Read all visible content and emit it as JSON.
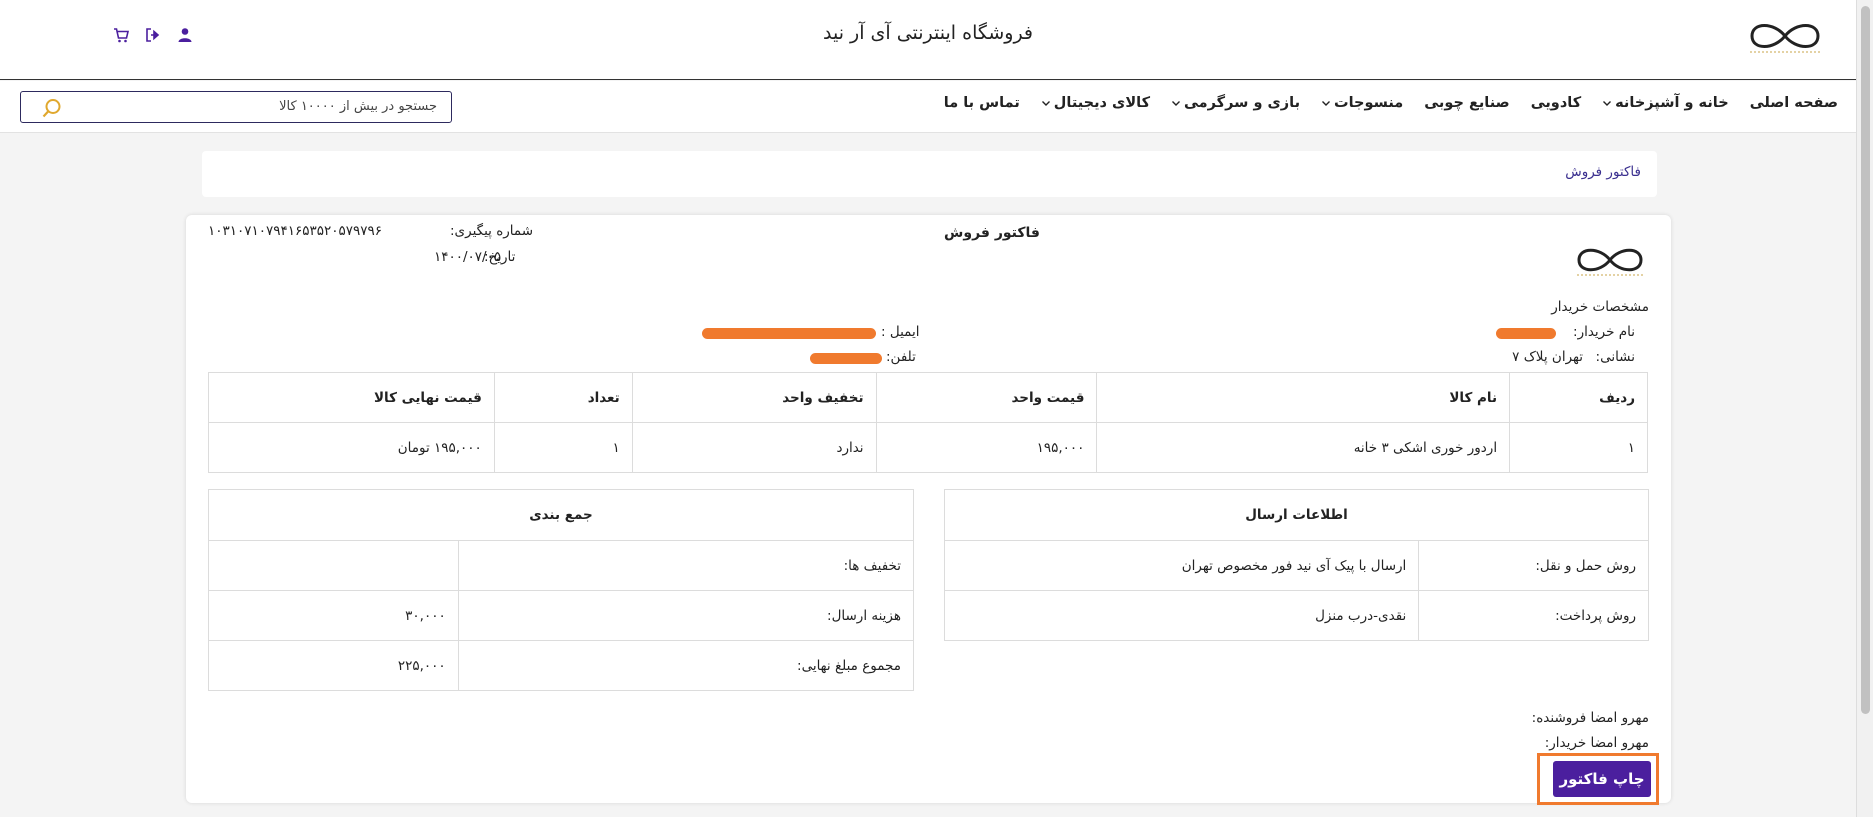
{
  "header": {
    "site_title": "فروشگاه اینترنتی آی آر نید",
    "icons": [
      "cart-icon",
      "logout-icon",
      "user-icon"
    ]
  },
  "nav": {
    "items": [
      {
        "label": "صفحه اصلی",
        "has_dropdown": false
      },
      {
        "label": "خانه و آشپزخانه",
        "has_dropdown": true
      },
      {
        "label": "کادویی",
        "has_dropdown": false
      },
      {
        "label": "صنایع چوبی",
        "has_dropdown": false
      },
      {
        "label": "منسوجات",
        "has_dropdown": true
      },
      {
        "label": "بازی و سرگرمی",
        "has_dropdown": true
      },
      {
        "label": "کالای دیجیتال",
        "has_dropdown": true
      },
      {
        "label": "تماس با ما",
        "has_dropdown": false
      }
    ],
    "search_placeholder": "جستجو در بیش از ۱۰۰۰۰ کالا"
  },
  "breadcrumb": "فاکتور فروش",
  "invoice": {
    "title": "فاکتور فروش",
    "tracking_label": "شماره پیگیری:",
    "tracking_value": "۱۰۳۱۰۷۱۰۷۹۴۱۶۵۳۵۲۰۵۷۹۷۹۶",
    "date_label": "تاریخ:",
    "date_value": "۱۴۰۰/۰۷/۰۵",
    "buyer_heading": "مشخصات خریدار",
    "buyer_name_label": "نام خریدار:",
    "address_label": "نشانی:",
    "address_value": "تهران پلاک ۷",
    "email_label": "ایمیل :",
    "phone_label": "تلفن:",
    "items": {
      "headers": [
        "ردیف",
        "نام کالا",
        "قیمت واحد",
        "تخفیف واحد",
        "تعداد",
        "قیمت نهایی کالا"
      ],
      "rows": [
        [
          "۱",
          "اردور خوری اشکی ۳ خانه",
          "۱۹۵,۰۰۰",
          "ندارد",
          "۱",
          "۱۹۵,۰۰۰ تومان"
        ]
      ]
    },
    "shipping": {
      "heading": "اطلاعات ارسال",
      "rows": [
        {
          "label": "روش حمل و نقل:",
          "value": "ارسال با پیک آی نید فور مخصوص تهران"
        },
        {
          "label": "روش پرداخت:",
          "value": "نقدی-درب منزل"
        }
      ]
    },
    "summary": {
      "heading": "جمع بندی",
      "rows": [
        {
          "label": "تخفیف ها:",
          "value": ""
        },
        {
          "label": "هزینه ارسال:",
          "value": "۳۰,۰۰۰"
        },
        {
          "label": "مجموع مبلغ نهایی:",
          "value": "۲۲۵,۰۰۰"
        }
      ]
    },
    "seller_sign": "مهرو امضا فروشنده:",
    "buyer_sign": "مهرو امضا خریدار:",
    "print_button": "چاپ فاکتور"
  },
  "colors": {
    "accent": "#4b1f9e",
    "highlight": "#f07a2e",
    "breadcrumb_text": "#3a2f8f",
    "search_icon": "#e0a82e"
  }
}
